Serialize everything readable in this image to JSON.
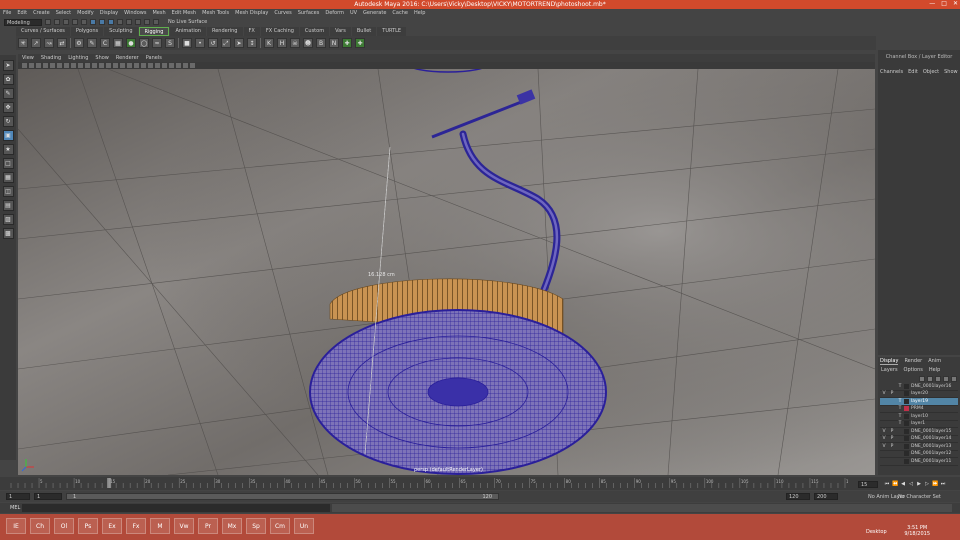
{
  "window": {
    "title": "Autodesk Maya 2016: C:\\Users\\Vicky\\Desktop\\VICKY\\MOTORTREND\\photoshoot.mb*"
  },
  "menubar": [
    "File",
    "Edit",
    "Create",
    "Select",
    "Modify",
    "Display",
    "Windows",
    "Mesh",
    "Edit Mesh",
    "Mesh Tools",
    "Mesh Display",
    "Curves",
    "Surfaces",
    "Deform",
    "UV",
    "Generate",
    "Cache",
    "Help"
  ],
  "statusline": {
    "mode": "Modeling",
    "live_surface": "No Live Surface"
  },
  "shelf_tabs": [
    "Curves / Surfaces",
    "Polygons",
    "Sculpting",
    "Rigging",
    "Animation",
    "Rendering",
    "FX",
    "FX Caching",
    "Custom",
    "Vars",
    "Bullet",
    "TURTLE"
  ],
  "active_shelf_tab": "Rigging",
  "panel_menu": [
    "View",
    "Shading",
    "Lighting",
    "Show",
    "Renderer",
    "Panels"
  ],
  "viewport": {
    "camera_label": "persp (defaultRenderLayer)",
    "measure_label": "16.128 cm"
  },
  "channel_box": {
    "title": "Channel Box / Layer Editor",
    "menu": [
      "Channels",
      "Edit",
      "Object",
      "Show"
    ]
  },
  "layer_editor": {
    "tabs": [
      "Display",
      "Render",
      "Anim"
    ],
    "active_tab": "Display",
    "menu": [
      "Layers",
      "Options",
      "Help"
    ],
    "layers": [
      {
        "v": "",
        "p": "",
        "t": "T",
        "name": "DNE_0001layer16",
        "color": "#2a2a2a",
        "selected": false
      },
      {
        "v": "V",
        "p": "P",
        "t": "",
        "name": "layer20",
        "color": "#2a2a2a",
        "selected": false
      },
      {
        "v": "",
        "p": "",
        "t": "T",
        "name": "layer19",
        "color": "#2a2a2a",
        "selected": true
      },
      {
        "v": "",
        "p": "",
        "t": "T",
        "name": "PRM4",
        "color": "#c0304a",
        "selected": false
      },
      {
        "v": "",
        "p": "",
        "t": "T",
        "name": "layer10",
        "color": "#2a2a2a",
        "selected": false
      },
      {
        "v": "",
        "p": "",
        "t": "T",
        "name": "layer1",
        "color": "#2a2a2a",
        "selected": false
      },
      {
        "v": "V",
        "p": "P",
        "t": "",
        "name": "DNE_0001layer15",
        "color": "#2a2a2a",
        "selected": false
      },
      {
        "v": "V",
        "p": "P",
        "t": "",
        "name": "DNE_0001layer14",
        "color": "#2a2a2a",
        "selected": false
      },
      {
        "v": "V",
        "p": "P",
        "t": "",
        "name": "DNE_0001layer13",
        "color": "#2a2a2a",
        "selected": false
      },
      {
        "v": "",
        "p": "",
        "t": "",
        "name": "DNE_0001layer12",
        "color": "#2a2a2a",
        "selected": false
      },
      {
        "v": "",
        "p": "",
        "t": "",
        "name": "DNE_0001layer11",
        "color": "#2a2a2a",
        "selected": false
      }
    ]
  },
  "time_slider": {
    "current_frame": "15",
    "ticks": [
      "5",
      "10",
      "15",
      "20",
      "25",
      "30",
      "35",
      "40",
      "45",
      "50",
      "55",
      "60",
      "65",
      "70",
      "75",
      "80",
      "85",
      "90",
      "95",
      "100",
      "105",
      "110",
      "115",
      "120"
    ]
  },
  "range_slider": {
    "start": "1",
    "start_inner": "1",
    "playback_start": "1",
    "end_inner": "120",
    "end": "120",
    "max": "200",
    "anim_layer": "No Anim Layer",
    "char_set": "No Character Set"
  },
  "command_line": {
    "label": "MEL"
  },
  "taskbar": {
    "desktop_label": "Desktop",
    "time": "3:51 PM",
    "date": "9/18/2015",
    "apps": [
      "IE",
      "Ch",
      "Ol",
      "Ps",
      "Ex",
      "Fx",
      "M",
      "Vw",
      "Pr",
      "Mx",
      "Sp",
      "Cm",
      "Un"
    ]
  }
}
